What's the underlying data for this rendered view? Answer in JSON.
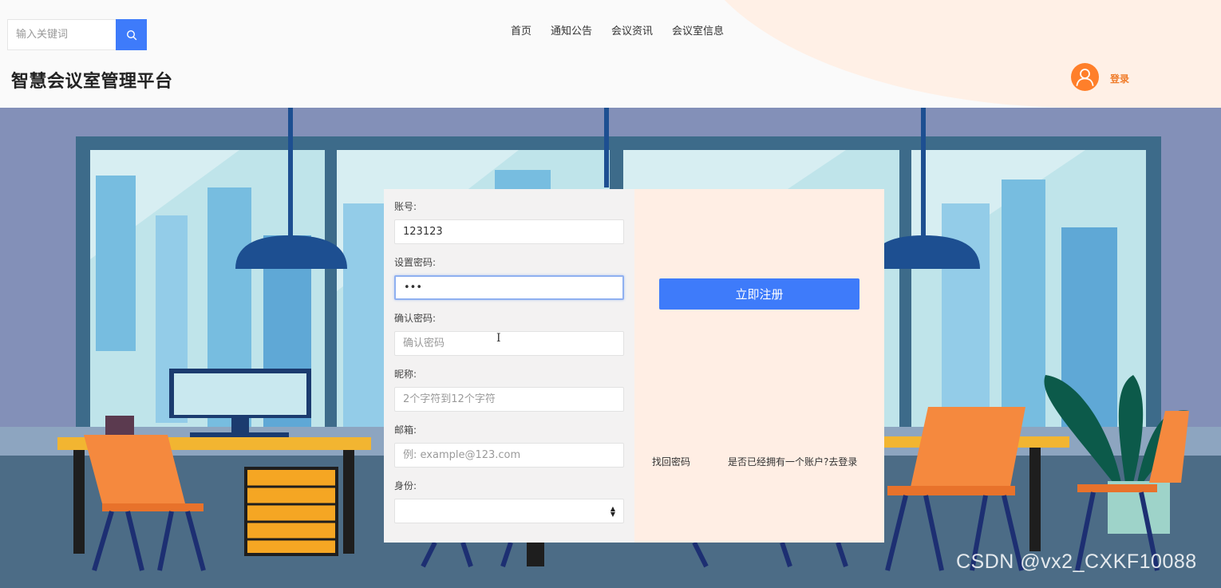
{
  "header": {
    "search": {
      "placeholder": "输入关键词"
    },
    "nav": [
      {
        "label": "首页"
      },
      {
        "label": "通知公告"
      },
      {
        "label": "会议资讯"
      },
      {
        "label": "会议室信息"
      }
    ],
    "site_title": "智慧会议室管理平台",
    "login_label": "登录"
  },
  "form": {
    "account": {
      "label": "账号:",
      "value": "123123"
    },
    "password": {
      "label": "设置密码:",
      "value": "•••"
    },
    "confirm_password": {
      "label": "确认密码:",
      "placeholder": "确认密码"
    },
    "nickname": {
      "label": "昵称:",
      "placeholder": "2个字符到12个字符"
    },
    "email": {
      "label": "邮箱:",
      "placeholder": "例: example@123.com"
    },
    "role": {
      "label": "身份:",
      "value": ""
    },
    "register_button": "立即注册",
    "forgot_password": "找回密码",
    "have_account": "是否已经拥有一个账户?去登录"
  },
  "watermark": "CSDN @vx2_CXKF10088",
  "colors": {
    "primary": "#3e7bfa",
    "accent_orange": "#f07c2a",
    "panel_left": "#f3f2f2",
    "panel_right": "#ffeee4",
    "scene_wall": "#8390b8"
  }
}
